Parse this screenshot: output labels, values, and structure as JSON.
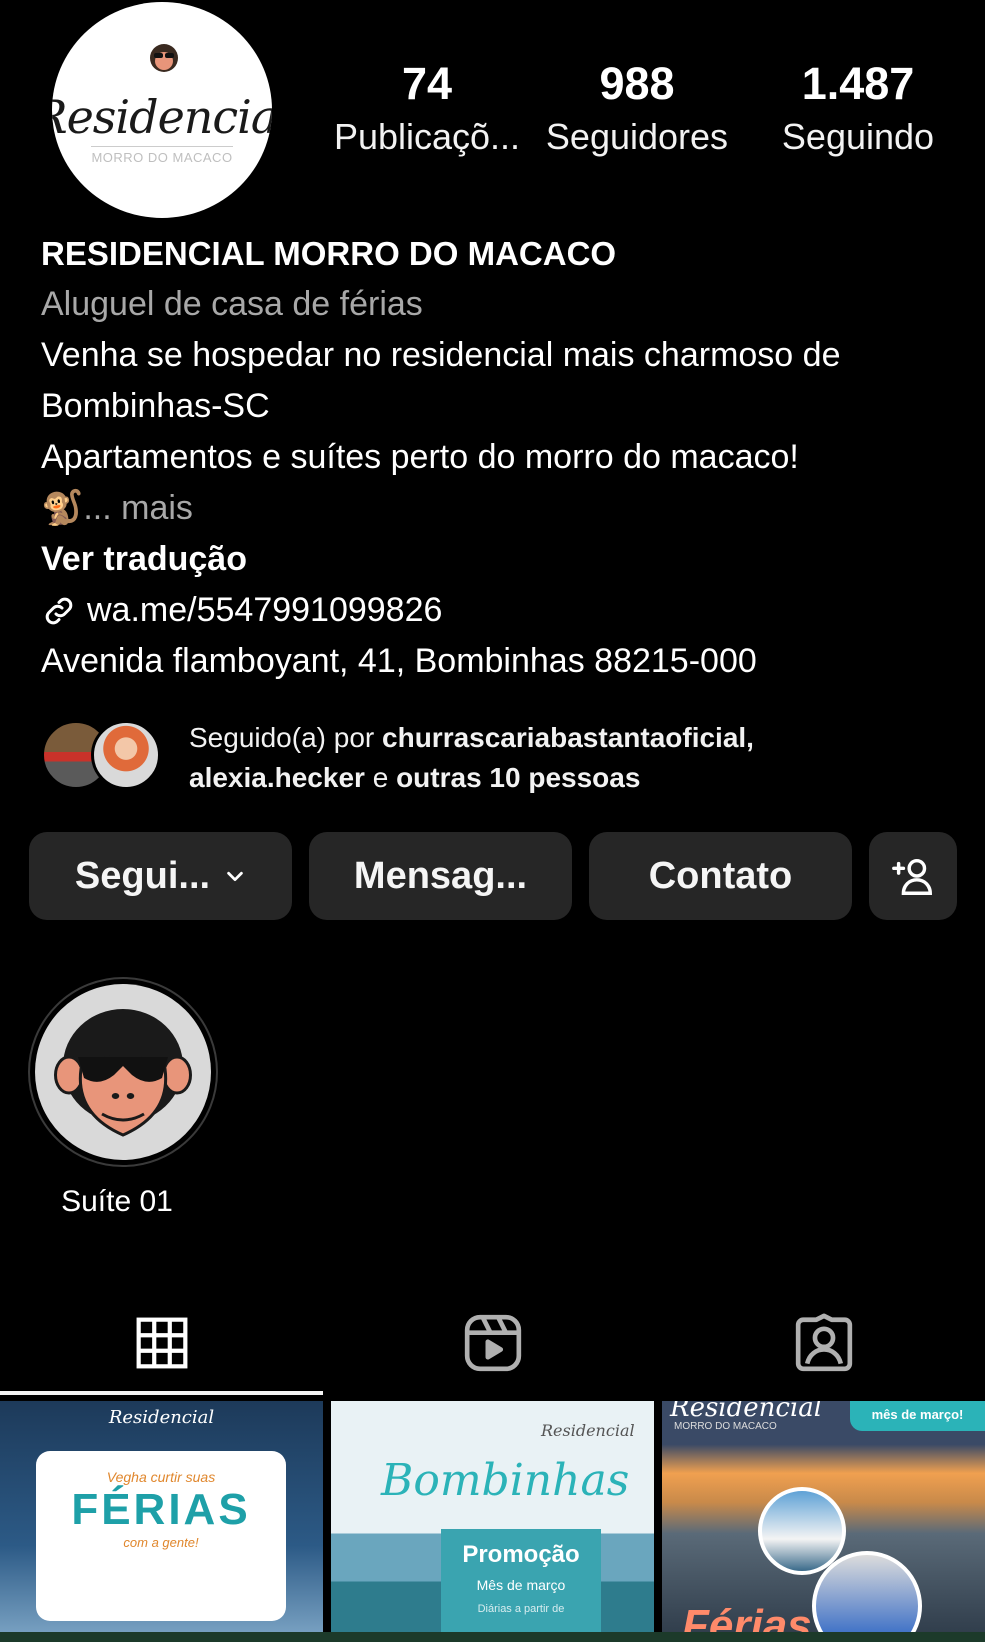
{
  "profile": {
    "avatar_logo_text": "Residencial",
    "avatar_logo_sub": "MORRO DO MACACO",
    "stats": {
      "posts_count": "74",
      "posts_label": "Publicaçõ...",
      "followers_count": "988",
      "followers_label": "Seguidores",
      "following_count": "1.487",
      "following_label": "Seguindo"
    }
  },
  "bio": {
    "name": "RESIDENCIAL MORRO DO MACACO",
    "category": "Aluguel de casa de férias",
    "line1": "Venha se hospedar no residencial mais charmoso de",
    "line2": "Bombinhas-SC",
    "line3": "Apartamentos e suítes perto do morro do macaco!",
    "emoji": "🐒",
    "more": "... mais",
    "translate": "Ver tradução",
    "link": "wa.me/5547991099826",
    "address": "Avenida flamboyant, 41, Bombinhas 88215-000"
  },
  "followed_by": {
    "prefix": "Seguido(a) por ",
    "user1": "churrascariabastantaoficial,",
    "user2": "alexia.hecker",
    "connector": " e ",
    "others": "outras 10 pessoas"
  },
  "actions": {
    "follow_label": "Segui...",
    "message_label": "Mensag...",
    "contact_label": "Contato",
    "add_icon": "add-person-icon"
  },
  "highlights": [
    {
      "label": "Suíte 01",
      "icon": "monkey-sunglasses"
    }
  ],
  "tabs": {
    "items": [
      "grid-icon",
      "reels-icon",
      "tagged-icon"
    ],
    "active": "grid-icon"
  },
  "posts": {
    "post1": {
      "logo": "Residencial",
      "small": "Vegha curtir suas",
      "big": "FÉRIAS",
      "sub": "com a gente!"
    },
    "post2": {
      "logo": "Residencial",
      "script": "Bombinhas",
      "promo": "Promoção",
      "month": "Mês de março",
      "daily": "Diárias a partir de"
    },
    "post3": {
      "logo": "Residencial",
      "logo_sub": "MORRO DO MACACO",
      "tag": "mês de março!",
      "word": "Férias"
    }
  },
  "colors": {
    "background": "#000000",
    "button_bg": "#262626",
    "muted_text": "#a8a8a8",
    "accent_teal": "#2bb3b8"
  }
}
